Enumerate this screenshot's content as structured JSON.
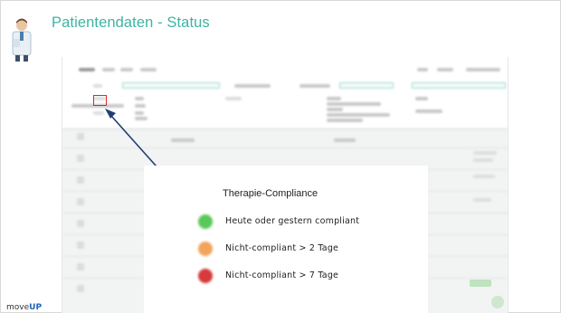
{
  "slide": {
    "title": "Patientendaten - Status",
    "brand_prefix": "move",
    "brand_suffix": "UP"
  },
  "legend": {
    "title": "Therapie-Compliance",
    "items": [
      {
        "label": "Heute oder gestern compliant",
        "color": "#5ac85a"
      },
      {
        "label": "Nicht-compliant > 2 Tage",
        "color": "#f2a35c"
      },
      {
        "label": "Nicht-compliant > 7 Tage",
        "color": "#d63a3a"
      }
    ]
  },
  "colors": {
    "title_accent": "#3cb4a4",
    "highlight": "#e8232a",
    "arrow": "#1f3f72"
  }
}
